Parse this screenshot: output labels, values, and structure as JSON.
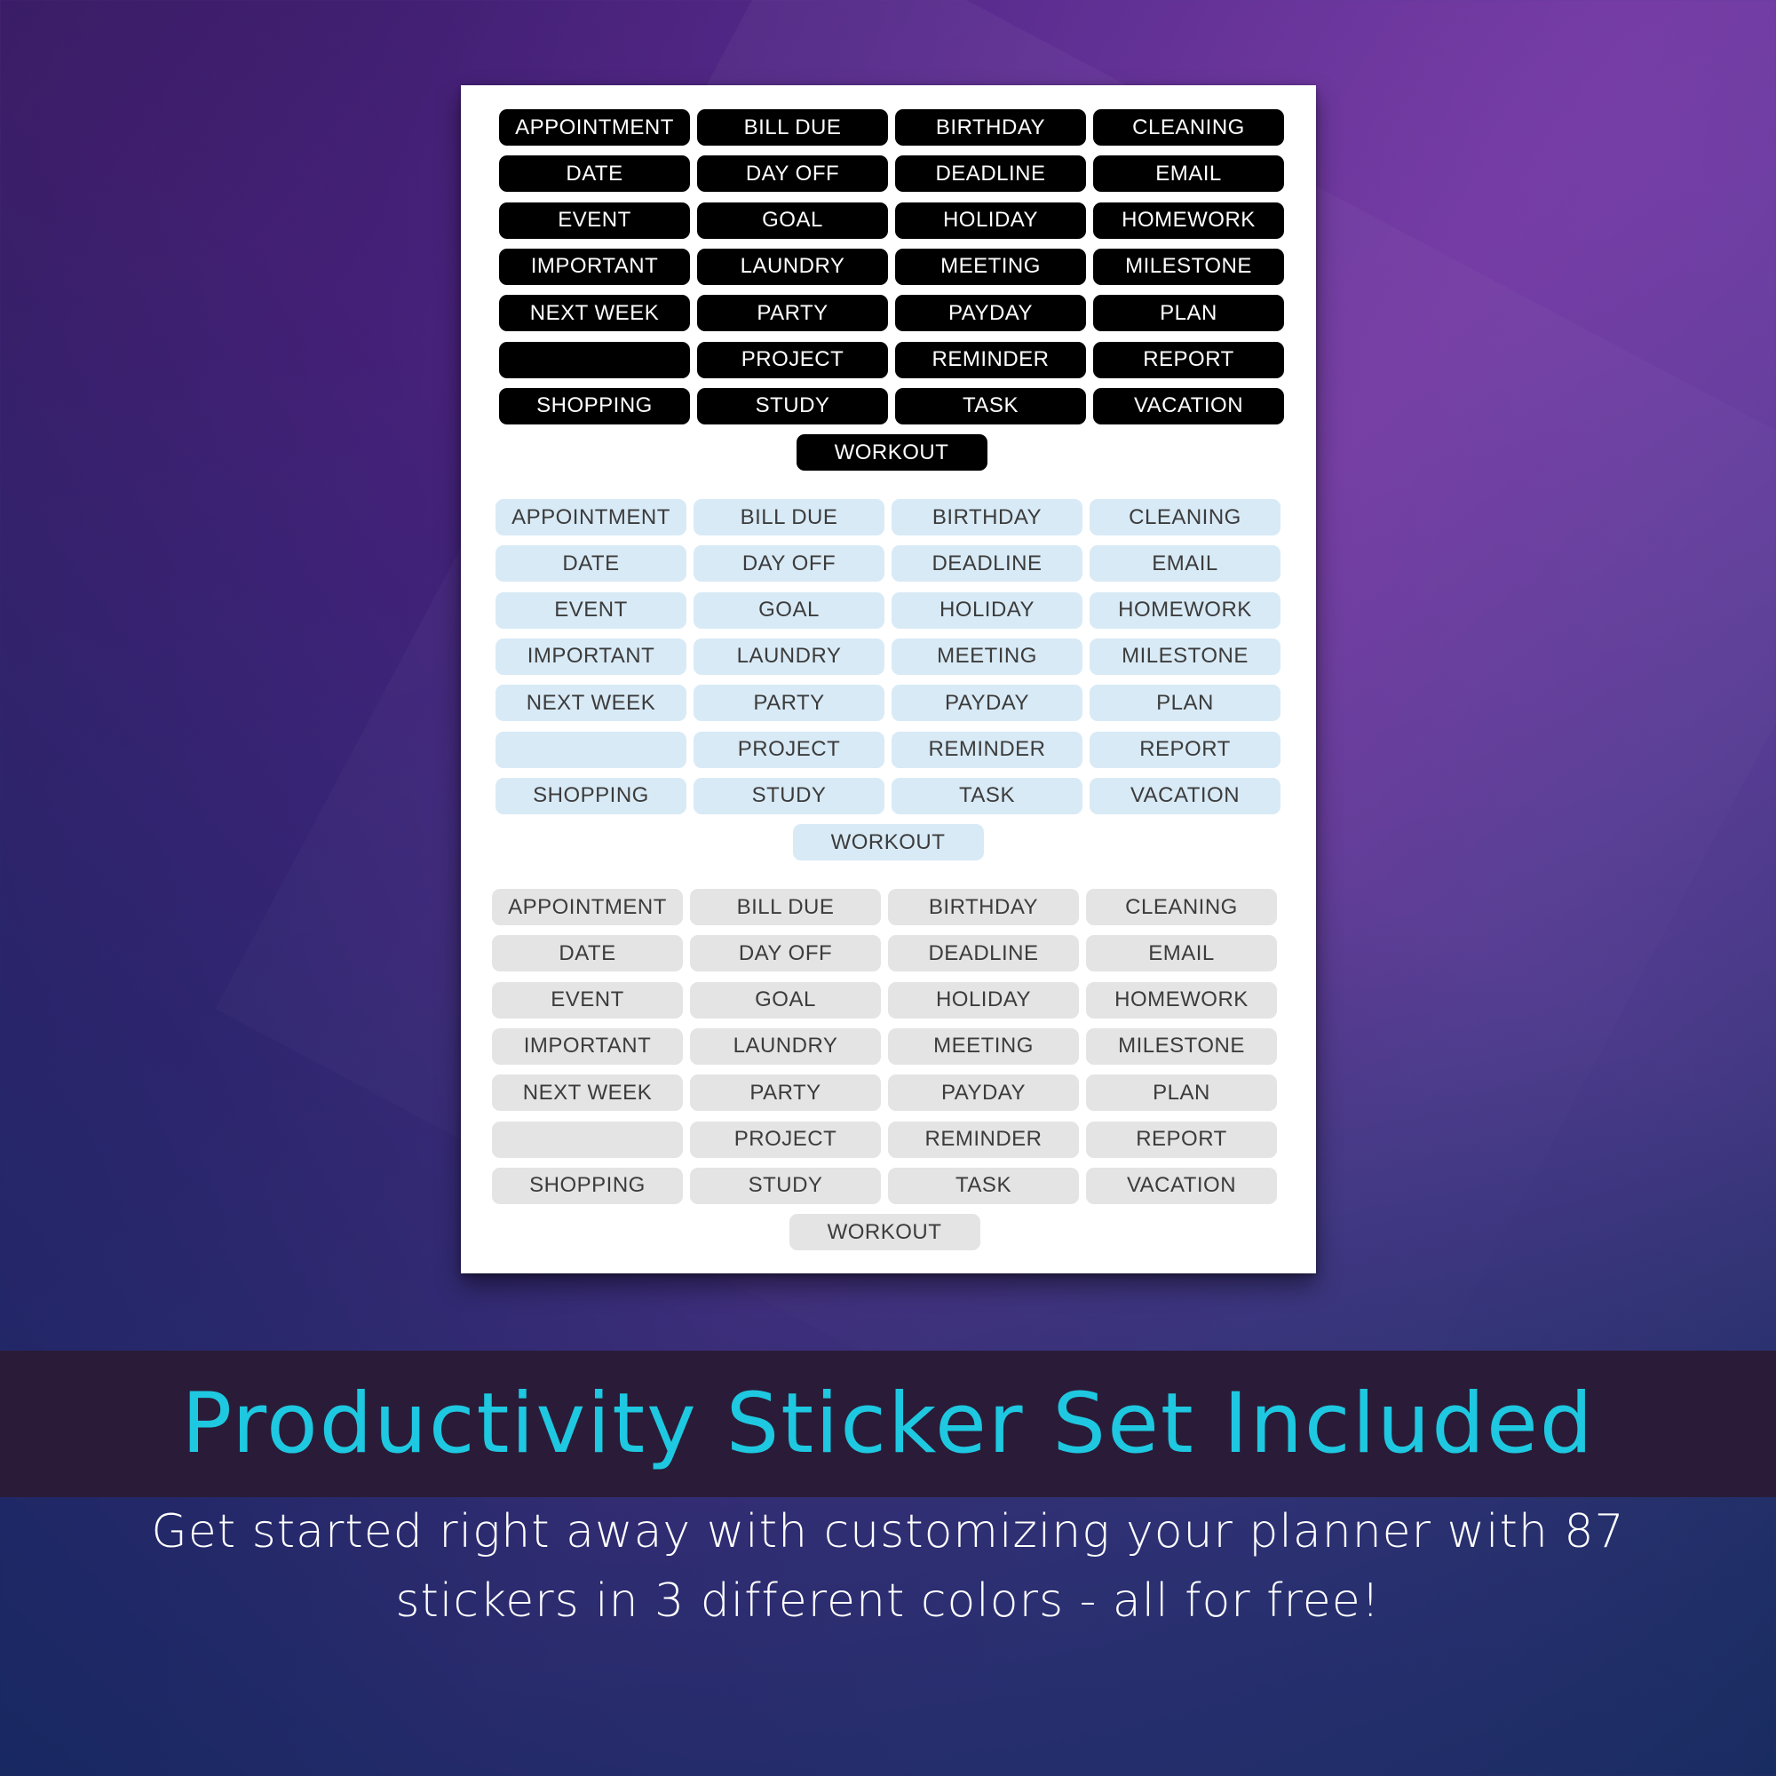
{
  "sticker_sheet": {
    "sets": [
      {
        "name": "black",
        "color": "#000000",
        "text_color": "#ffffff",
        "labels": [
          "APPOINTMENT",
          "BILL DUE",
          "BIRTHDAY",
          "CLEANING",
          "DATE",
          "DAY OFF",
          "DEADLINE",
          "EMAIL",
          "EVENT",
          "GOAL",
          "HOLIDAY",
          "HOMEWORK",
          "IMPORTANT",
          "LAUNDRY",
          "MEETING",
          "MILESTONE",
          "NEXT WEEK",
          "PARTY",
          "PAYDAY",
          "PLAN",
          "",
          "PROJECT",
          "REMINDER",
          "REPORT",
          "SHOPPING",
          "STUDY",
          "TASK",
          "VACATION",
          "WORKOUT"
        ]
      },
      {
        "name": "blue",
        "color": "#d8eaf6",
        "text_color": "#3c3c3c",
        "labels": [
          "APPOINTMENT",
          "BILL DUE",
          "BIRTHDAY",
          "CLEANING",
          "DATE",
          "DAY OFF",
          "DEADLINE",
          "EMAIL",
          "EVENT",
          "GOAL",
          "HOLIDAY",
          "HOMEWORK",
          "IMPORTANT",
          "LAUNDRY",
          "MEETING",
          "MILESTONE",
          "NEXT WEEK",
          "PARTY",
          "PAYDAY",
          "PLAN",
          "",
          "PROJECT",
          "REMINDER",
          "REPORT",
          "SHOPPING",
          "STUDY",
          "TASK",
          "VACATION",
          "WORKOUT"
        ]
      },
      {
        "name": "gray",
        "color": "#e4e4e4",
        "text_color": "#3c3c3c",
        "labels": [
          "APPOINTMENT",
          "BILL DUE",
          "BIRTHDAY",
          "CLEANING",
          "DATE",
          "DAY OFF",
          "DEADLINE",
          "EMAIL",
          "EVENT",
          "GOAL",
          "HOLIDAY",
          "HOMEWORK",
          "IMPORTANT",
          "LAUNDRY",
          "MEETING",
          "MILESTONE",
          "NEXT WEEK",
          "PARTY",
          "PAYDAY",
          "PLAN",
          "",
          "PROJECT",
          "REMINDER",
          "REPORT",
          "SHOPPING",
          "STUDY",
          "TASK",
          "VACATION",
          "WORKOUT"
        ]
      }
    ]
  },
  "banner": {
    "title": "Productivity Sticker Set Included",
    "title_color": "#1ec8e0",
    "background": "#2a1c38"
  },
  "description": {
    "line1": "Get started right away with customizing your planner with 87",
    "line2": "stickers in 3 different colors - all for free!"
  }
}
